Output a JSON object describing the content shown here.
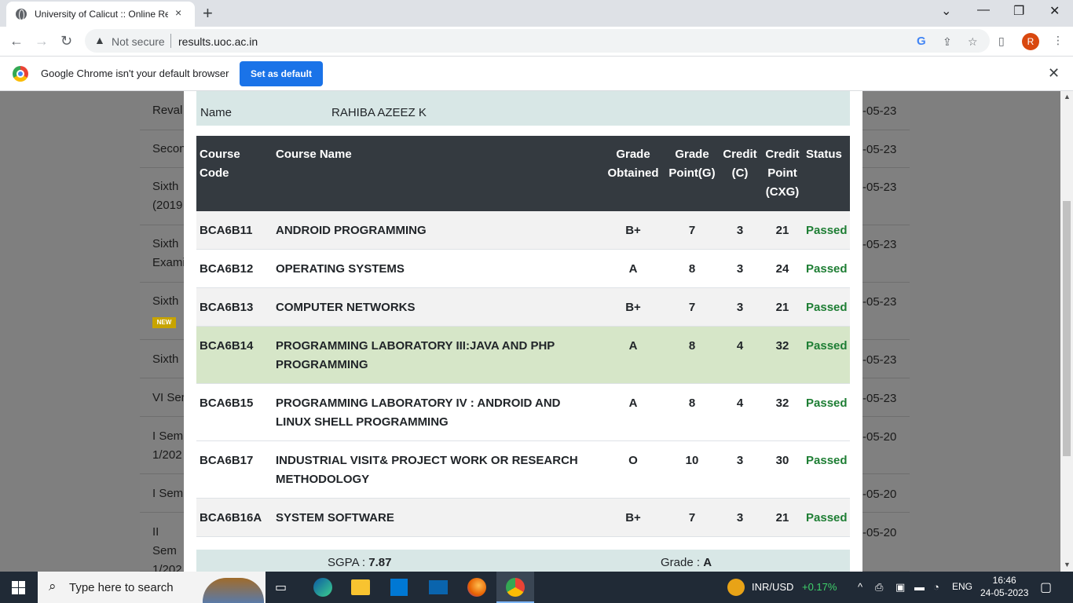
{
  "browser": {
    "tab_title": "University of Calicut :: Online Res",
    "new_tab": "+",
    "tab_close": "×",
    "security_label": "Not secure",
    "url": "results.uoc.ac.in",
    "profile_initial": "R",
    "infobar_text": "Google Chrome isn't your default browser",
    "set_default_label": "Set as default"
  },
  "background_list": [
    {
      "text": "Reval",
      "date": "-05-23"
    },
    {
      "text": "Secon",
      "date": "-05-23"
    },
    {
      "text": "Sixth (2019",
      "date": "-05-23"
    },
    {
      "text": "Sixth Exami",
      "date": "-05-23"
    },
    {
      "text": "Sixth",
      "date": "-05-23"
    },
    {
      "text": "Sixth",
      "date": "-05-23"
    },
    {
      "text": "VI Ser",
      "date": "-05-23"
    },
    {
      "text": "I Sem 1/202",
      "date": "-05-20"
    },
    {
      "text": "I Sem",
      "date": "-05-20"
    },
    {
      "text": "II Sem 1/202",
      "date": "-05-20"
    }
  ],
  "new_badge": "NEW",
  "student": {
    "name_label": "Name",
    "name_value": "RAHIBA AZEEZ K"
  },
  "table": {
    "headers": {
      "course_code": "Course Code",
      "course_name": "Course Name",
      "grade": "Grade Obtained",
      "grade_point": "Grade Point(G)",
      "credit": "Credit (C)",
      "credit_point": "Credit Point (CXG)",
      "status": "Status"
    },
    "rows": [
      {
        "code": "BCA6B11",
        "name": "ANDROID PROGRAMMING",
        "grade": "B+",
        "gp": "7",
        "credit": "3",
        "cp": "21",
        "status": "Passed"
      },
      {
        "code": "BCA6B12",
        "name": "OPERATING SYSTEMS",
        "grade": "A",
        "gp": "8",
        "credit": "3",
        "cp": "24",
        "status": "Passed"
      },
      {
        "code": "BCA6B13",
        "name": "COMPUTER NETWORKS",
        "grade": "B+",
        "gp": "7",
        "credit": "3",
        "cp": "21",
        "status": "Passed"
      },
      {
        "code": "BCA6B14",
        "name": "PROGRAMMING LABORATORY III:JAVA AND PHP PROGRAMMING",
        "grade": "A",
        "gp": "8",
        "credit": "4",
        "cp": "32",
        "status": "Passed"
      },
      {
        "code": "BCA6B15",
        "name": "PROGRAMMING LABORATORY IV : ANDROID AND LINUX SHELL PROGRAMMING",
        "grade": "A",
        "gp": "8",
        "credit": "4",
        "cp": "32",
        "status": "Passed"
      },
      {
        "code": "BCA6B17",
        "name": "INDUSTRIAL VISIT& PROJECT WORK OR RESEARCH METHODOLOGY",
        "grade": "O",
        "gp": "10",
        "credit": "3",
        "cp": "30",
        "status": "Passed"
      },
      {
        "code": "BCA6B16A",
        "name": "SYSTEM SOFTWARE",
        "grade": "B+",
        "gp": "7",
        "credit": "3",
        "cp": "21",
        "status": "Passed"
      }
    ]
  },
  "summary": {
    "sgpa_label": "SGPA : ",
    "sgpa_value": "7.87",
    "grade_label": "Grade : ",
    "grade_value": "A"
  },
  "taskbar": {
    "search_placeholder": "Type here to search",
    "ticker_label": "INR/USD",
    "ticker_change": "+0.17%",
    "language": "ENG",
    "time": "16:46",
    "date": "24-05-2023"
  },
  "colors": {
    "header_bg": "#343a40",
    "highlight_row": "#d6e6c8",
    "passed": "#1e7e34",
    "overlay": "#7f7f7f"
  }
}
